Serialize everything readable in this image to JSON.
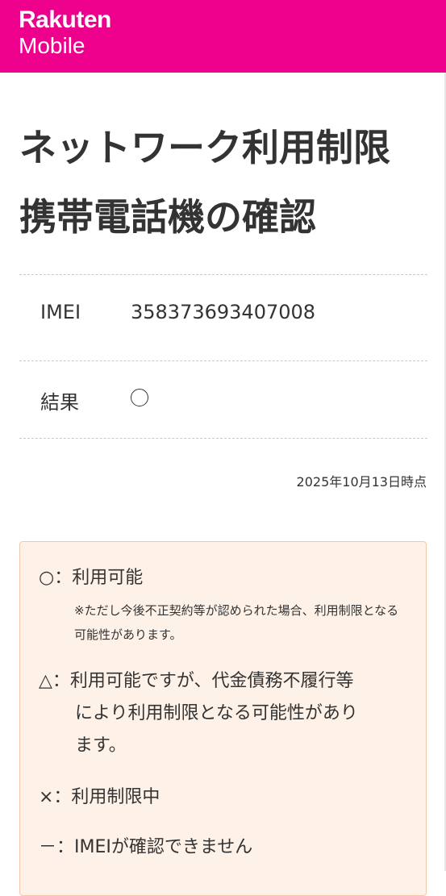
{
  "header": {
    "brand_line1": "Rakuten",
    "brand_line2": "Mobile",
    "color": "#ec008c"
  },
  "page": {
    "title": "ネットワーク利用制限携帯電話機の確認"
  },
  "details": {
    "imei_label": "IMEI",
    "imei_value": "358373693407008",
    "result_label": "結果",
    "result_icon": "circle-mark"
  },
  "timestamp": "2025年10月13日時点",
  "legend": {
    "ok": "○：利用可能",
    "ok_note": "※ただし今後不正契約等が認められた場合、利用制限となる可能性があります。",
    "warn_line1": "△：利用可能ですが、代金債務不履行等",
    "warn_line2": "により利用制限となる可能性があり",
    "warn_line3": "ます。",
    "restricted": "×：利用制限中",
    "unconfirmed": "－：IMEIが確認できません"
  },
  "colors": {
    "legend_bg": "#fdf1e8",
    "legend_border": "#f3c8aa",
    "text": "#333333"
  }
}
